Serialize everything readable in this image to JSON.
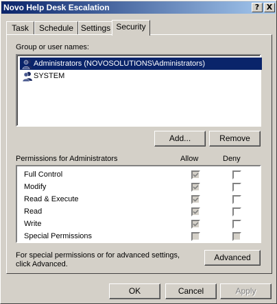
{
  "window": {
    "title": "Novo Help Desk Escalation",
    "help_button": "?",
    "close_button": "X"
  },
  "tabs": [
    {
      "label": "Task"
    },
    {
      "label": "Schedule"
    },
    {
      "label": "Settings"
    },
    {
      "label": "Security",
      "active": true
    }
  ],
  "security": {
    "group_label": "Group or user names:",
    "users": [
      {
        "name": "Administrators (NOVOSOLUTIONS\\Administrators)",
        "selected": true,
        "icon": "user-group-icon"
      },
      {
        "name": "SYSTEM",
        "selected": false,
        "icon": "user-group-icon"
      }
    ],
    "add_button": "Add...",
    "remove_button": "Remove",
    "permissions_label": "Permissions for Administrators",
    "allow_header": "Allow",
    "deny_header": "Deny",
    "permissions": [
      {
        "name": "Full Control",
        "allow": true,
        "allow_disabled": true,
        "deny": false,
        "deny_disabled": false
      },
      {
        "name": "Modify",
        "allow": true,
        "allow_disabled": true,
        "deny": false,
        "deny_disabled": false
      },
      {
        "name": "Read & Execute",
        "allow": true,
        "allow_disabled": true,
        "deny": false,
        "deny_disabled": false
      },
      {
        "name": "Read",
        "allow": true,
        "allow_disabled": true,
        "deny": false,
        "deny_disabled": false
      },
      {
        "name": "Write",
        "allow": true,
        "allow_disabled": true,
        "deny": false,
        "deny_disabled": false
      },
      {
        "name": "Special Permissions",
        "allow": false,
        "allow_disabled": true,
        "deny": false,
        "deny_disabled": true
      }
    ],
    "advanced_text_1": "For special permissions or for advanced settings,",
    "advanced_text_2": "click Advanced.",
    "advanced_button": "Advanced"
  },
  "footer": {
    "ok_button": "OK",
    "cancel_button": "Cancel",
    "apply_button": "Apply"
  },
  "colors": {
    "titlebar": "#0a246a",
    "selection": "#0a246a",
    "face": "#d4d0c8"
  }
}
